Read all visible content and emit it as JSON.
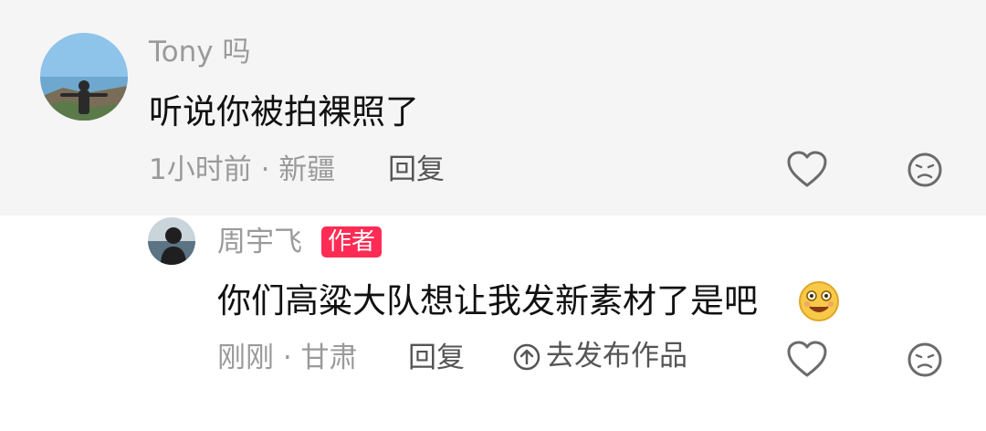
{
  "comments": [
    {
      "username": "Tony 吗",
      "text": "听说你被拍裸照了",
      "meta": "1小时前 · 新疆",
      "reply_label": "回复",
      "avatar_icon": "person-scenic-avatar",
      "like_icon": "heart-outline-icon",
      "dislike_icon": "sad-face-icon"
    },
    {
      "username": "周宇飞",
      "badge": "作者",
      "text": "你们高粱大队想让我发新素材了是吧",
      "emoji": "smiling-emoji",
      "meta": "刚刚 · 甘肃",
      "reply_label": "回复",
      "publish_label": "去发布作品",
      "avatar_icon": "person-sea-avatar",
      "like_icon": "heart-outline-icon",
      "dislike_icon": "sad-face-icon"
    }
  ],
  "colors": {
    "author_badge": "#fe2c55",
    "first_comment_bg": "#f5f5f5",
    "username": "#9a9a9a"
  }
}
